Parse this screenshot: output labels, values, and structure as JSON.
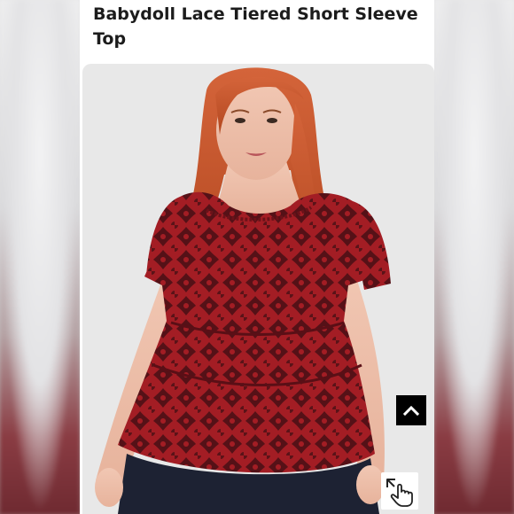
{
  "product": {
    "title": "Babydoll Lace Tiered Short Sleeve Top"
  },
  "photo": {
    "subject": "model wearing red lace tiered top",
    "top_color": "#a31d24",
    "lace_color": "#2a0c10",
    "hair_color": "#c9562a"
  },
  "controls": {
    "scroll_top_icon": "chevron-up-icon",
    "zoom_icon": "pinch-zoom-hand-icon"
  }
}
